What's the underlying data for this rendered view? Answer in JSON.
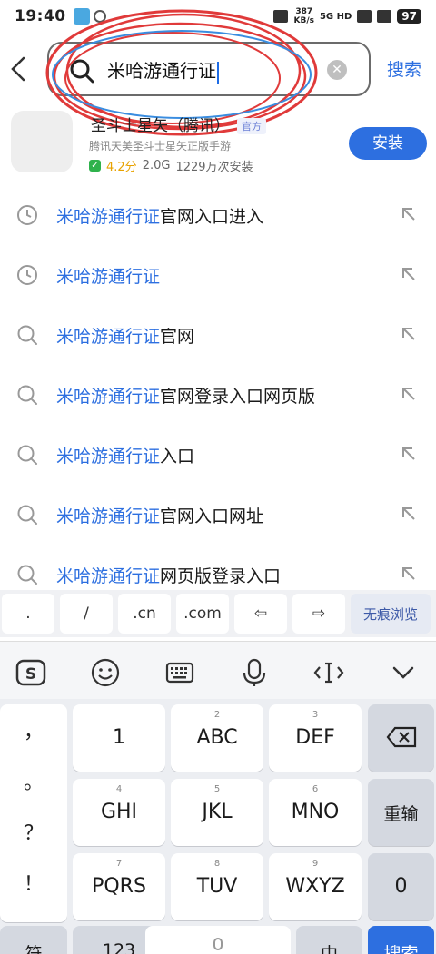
{
  "status_bar": {
    "time": "19:40",
    "net_speed": "387",
    "net_unit": "KB/s",
    "net_type": "5G HD",
    "battery": "97"
  },
  "header": {
    "back_icon": "chevron-left-icon",
    "search_query": "米哈游通行证",
    "search_button": "搜索"
  },
  "app_result": {
    "name": "圣斗士星矢（腾讯）",
    "official_badge": "官方",
    "description": "腾讯天美圣斗士星矢正版手游",
    "rating": "4.2分",
    "size": "2.0G",
    "installs": "1229万次安装",
    "install_button": "安装"
  },
  "suggestions": [
    {
      "icon": "history-icon",
      "highlight": "米哈游通行证",
      "rest": "官网入口进入"
    },
    {
      "icon": "history-icon",
      "highlight": "米哈游通行证",
      "rest": ""
    },
    {
      "icon": "search-icon",
      "highlight": "米哈游通行证",
      "rest": "官网"
    },
    {
      "icon": "search-icon",
      "highlight": "米哈游通行证",
      "rest": "官网登录入口网页版"
    },
    {
      "icon": "search-icon",
      "highlight": "米哈游通行证",
      "rest": "入口"
    },
    {
      "icon": "search-icon",
      "highlight": "米哈游通行证",
      "rest": "官网入口网址"
    },
    {
      "icon": "search-icon",
      "highlight": "米哈游通行证",
      "rest": "网页版登录入口"
    }
  ],
  "shortcuts": [
    ".",
    "/",
    ".cn",
    ".com",
    "⇦",
    "⇨",
    "无痕浏览"
  ],
  "keyboard": {
    "punct": [
      "，",
      "。",
      "？",
      "！"
    ],
    "keys": [
      {
        "sub": "",
        "main": "1"
      },
      {
        "sub": "2",
        "main": "ABC"
      },
      {
        "sub": "3",
        "main": "DEF"
      },
      {
        "sub": "4",
        "main": "GHI"
      },
      {
        "sub": "5",
        "main": "JKL"
      },
      {
        "sub": "6",
        "main": "MNO"
      },
      {
        "sub": "7",
        "main": "PQRS"
      },
      {
        "sub": "8",
        "main": "TUV"
      },
      {
        "sub": "9",
        "main": "WXYZ"
      }
    ],
    "reenter": "重输",
    "zero": "0",
    "bottom": [
      "符",
      "123",
      "",
      "中",
      "搜索"
    ]
  }
}
